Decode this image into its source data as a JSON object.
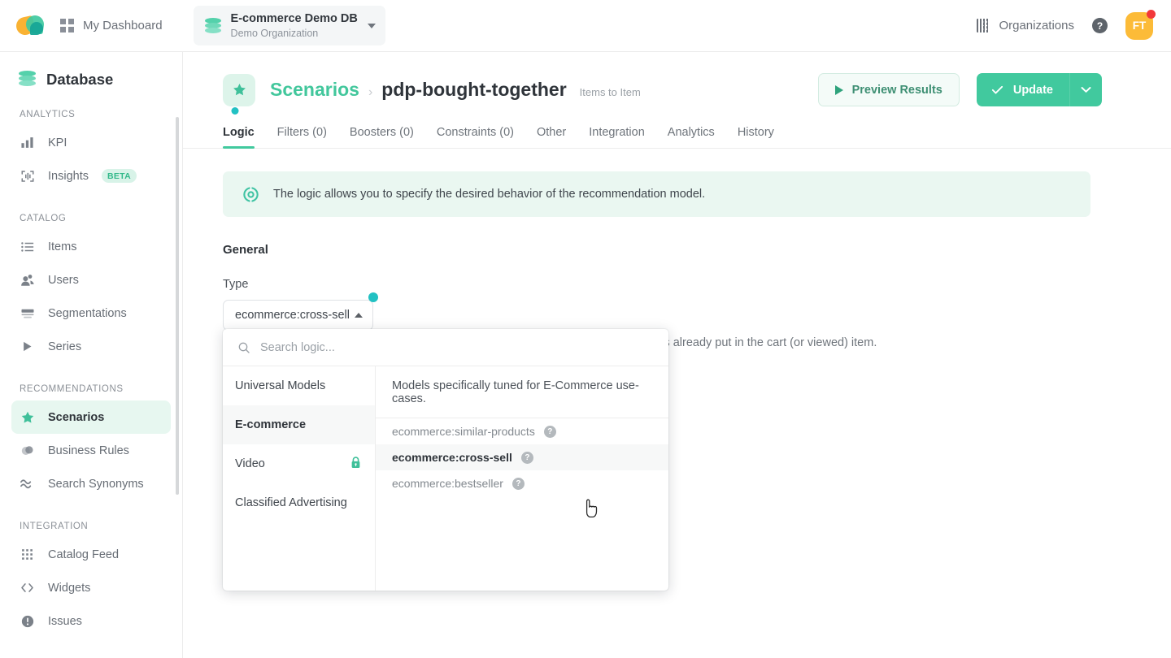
{
  "colors": {
    "brand_green": "#41c99e",
    "teal_dot": "#22c1c3",
    "banner_bg": "#eaf7f1",
    "active_nav_bg": "#e7f7f0",
    "avatar_bg": "#fcbb38",
    "notification_red": "#f2383a"
  },
  "topbar": {
    "logo_name": "app-logo",
    "dashboard_label": "My Dashboard",
    "db_name": "E-commerce Demo DB",
    "db_org": "Demo Organization",
    "organizations_label": "Organizations",
    "help_glyph": "?",
    "avatar_initials": "FT"
  },
  "sidebar": {
    "title": "Database",
    "groups": [
      {
        "label": "ANALYTICS",
        "items": [
          {
            "label": "KPI",
            "icon": "bar-chart-icon",
            "active": false,
            "badge": null
          },
          {
            "label": "Insights",
            "icon": "insights-icon",
            "active": false,
            "badge": "BETA"
          }
        ]
      },
      {
        "label": "CATALOG",
        "items": [
          {
            "label": "Items",
            "icon": "list-icon",
            "active": false,
            "badge": null
          },
          {
            "label": "Users",
            "icon": "users-icon",
            "active": false,
            "badge": null
          },
          {
            "label": "Segmentations",
            "icon": "segmentations-icon",
            "active": false,
            "badge": null
          },
          {
            "label": "Series",
            "icon": "play-triangle-icon",
            "active": false,
            "badge": null
          }
        ]
      },
      {
        "label": "RECOMMENDATIONS",
        "items": [
          {
            "label": "Scenarios",
            "icon": "star-icon",
            "active": true,
            "badge": null
          },
          {
            "label": "Business Rules",
            "icon": "business-rules-icon",
            "active": false,
            "badge": null
          },
          {
            "label": "Search Synonyms",
            "icon": "approx-equal-icon",
            "active": false,
            "badge": null
          }
        ]
      },
      {
        "label": "INTEGRATION",
        "items": [
          {
            "label": "Catalog Feed",
            "icon": "grid-dots-icon",
            "active": false,
            "badge": null
          },
          {
            "label": "Widgets",
            "icon": "code-brackets-icon",
            "active": false,
            "badge": null
          },
          {
            "label": "Issues",
            "icon": "exclamation-circle-icon",
            "active": false,
            "badge": null
          }
        ]
      }
    ]
  },
  "page": {
    "breadcrumb_parent": "Scenarios",
    "breadcrumb_sep": "›",
    "breadcrumb_current": "pdp-bought-together",
    "breadcrumb_subtitle": "Items to Item",
    "preview_button": "Preview Results",
    "update_button": "Update"
  },
  "tabs": [
    {
      "label": "Logic",
      "active": true,
      "dot": true
    },
    {
      "label": "Filters (0)",
      "active": false,
      "dot": false
    },
    {
      "label": "Boosters (0)",
      "active": false,
      "dot": false
    },
    {
      "label": "Constraints (0)",
      "active": false,
      "dot": false
    },
    {
      "label": "Other",
      "active": false,
      "dot": false
    },
    {
      "label": "Integration",
      "active": false,
      "dot": false
    },
    {
      "label": "Analytics",
      "active": false,
      "dot": false
    },
    {
      "label": "History",
      "active": false,
      "dot": false
    }
  ],
  "banner": {
    "text": "The logic allows you to specify the desired behavior of the recommendation model."
  },
  "form": {
    "section_title": "General",
    "type_label": "Type",
    "type_value": "ecommerce:cross-sell",
    "description_behind": "In this customer-based case, the products are compatible with those that the user has already put in the cart (or viewed) item."
  },
  "dropdown": {
    "search_placeholder": "Search logic...",
    "search_value": "",
    "categories": [
      {
        "label": "Universal Models",
        "active": false,
        "locked": false
      },
      {
        "label": "E-commerce",
        "active": true,
        "locked": false
      },
      {
        "label": "Video",
        "active": false,
        "locked": true
      },
      {
        "label": "Classified Advertising",
        "active": false,
        "locked": false
      }
    ],
    "category_description": "Models specifically tuned for E-Commerce use-cases.",
    "options": [
      {
        "label": "ecommerce:similar-products",
        "selected": false,
        "help": "?"
      },
      {
        "label": "ecommerce:cross-sell",
        "selected": true,
        "help": "?"
      },
      {
        "label": "ecommerce:bestseller",
        "selected": false,
        "help": "?"
      }
    ]
  }
}
